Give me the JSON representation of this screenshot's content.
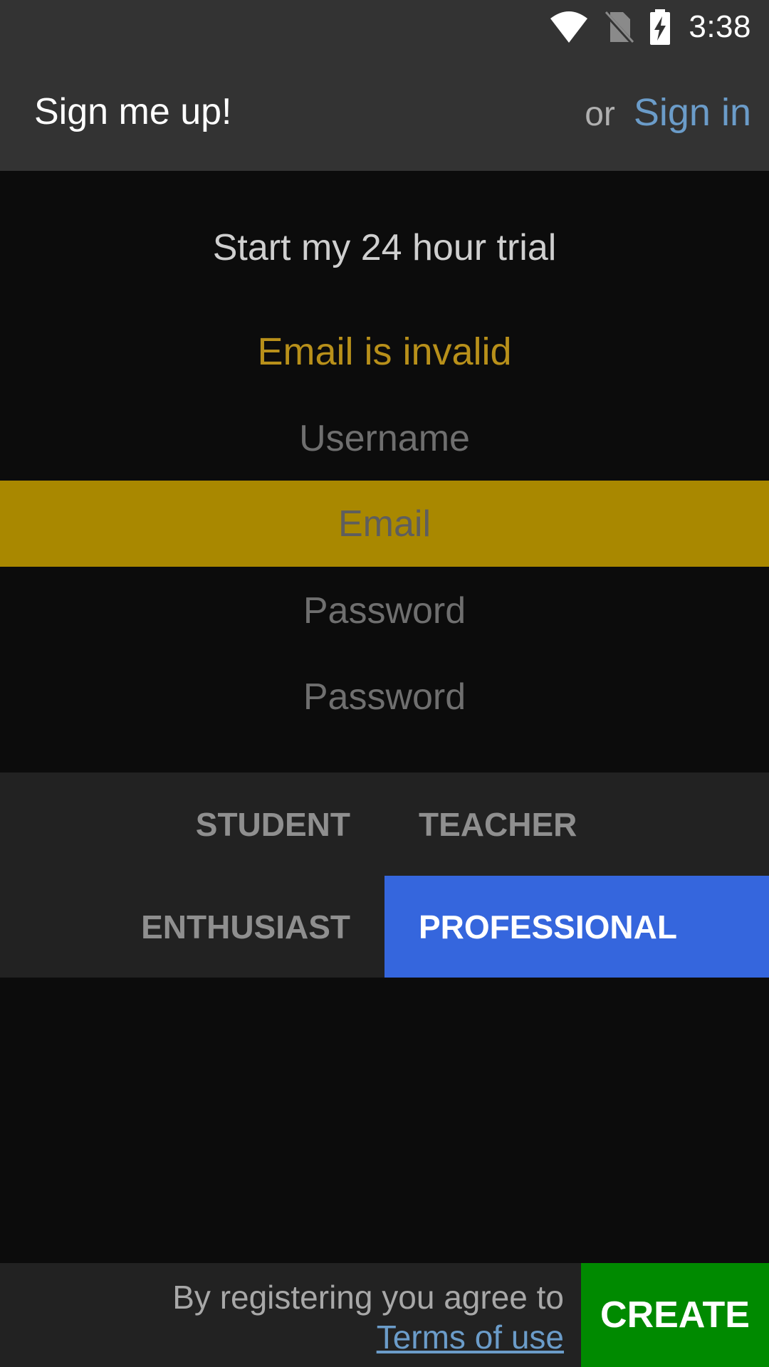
{
  "status_bar": {
    "time": "3:38",
    "icons": [
      "wifi-icon",
      "no-sim-icon",
      "battery-charging-icon"
    ]
  },
  "app_bar": {
    "title": "Sign me up!",
    "or_text": "or",
    "sign_in_label": "Sign in"
  },
  "form": {
    "heading": "Start my 24 hour trial",
    "error": "Email is invalid",
    "username_placeholder": "Username",
    "email_placeholder": "Email",
    "password_placeholder": "Password",
    "confirm_password_placeholder": "Password"
  },
  "roles": {
    "student": "STUDENT",
    "teacher": "TEACHER",
    "enthusiast": "ENTHUSIAST",
    "professional": "PROFESSIONAL",
    "selected": "PROFESSIONAL"
  },
  "footer": {
    "agree_text": "By registering you agree to",
    "terms_label": "Terms of use",
    "create_label": "CREATE"
  },
  "colors": {
    "error": "#b8901a",
    "highlight_field": "#a98800",
    "selected_role": "#3566dd",
    "create_button": "#008a00",
    "link": "#6b9cc9"
  }
}
